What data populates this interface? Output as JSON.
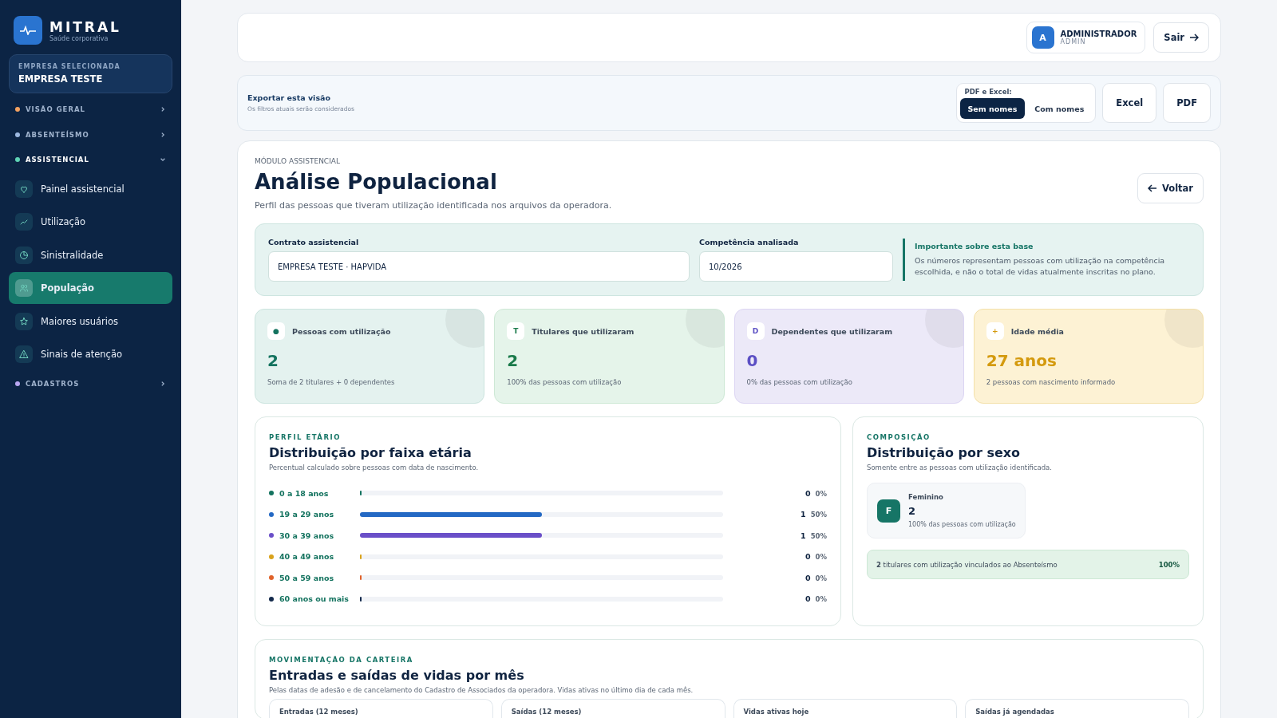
{
  "brand": {
    "name": "MITRAL",
    "tagline": "Saúde corporativa"
  },
  "company": {
    "label": "EMPRESA SELECIONADA",
    "name": "EMPRESA TESTE"
  },
  "nav": [
    {
      "label": "VISÃO GERAL",
      "color": "#f4a261",
      "expanded": false
    },
    {
      "label": "ABSENTEÍSMO",
      "color": "#9db8e0",
      "expanded": false
    },
    {
      "label": "ASSISTENCIAL",
      "color": "#5fd3b5",
      "expanded": true,
      "children": [
        {
          "label": "Painel assistencial",
          "selected": false
        },
        {
          "label": "Utilização",
          "selected": false
        },
        {
          "label": "Sinistralidade",
          "selected": false
        },
        {
          "label": "População",
          "selected": true
        },
        {
          "label": "Maiores usuários",
          "selected": false
        },
        {
          "label": "Sinais de atenção",
          "selected": false
        }
      ]
    },
    {
      "label": "CADASTROS",
      "color": "#b9a6f0",
      "expanded": false
    }
  ],
  "user": {
    "initial": "A",
    "name": "ADMINISTRADOR",
    "role": "ADMIN"
  },
  "logout": "Sair",
  "export": {
    "title": "Exportar esta visão",
    "subtitle": "Os filtros atuais serão considerados",
    "group_label": "PDF e Excel:",
    "options": [
      {
        "label": "Sem nomes",
        "selected": true
      },
      {
        "label": "Com nomes",
        "selected": false
      }
    ],
    "buttons": [
      "Excel",
      "PDF"
    ]
  },
  "header": {
    "eyebrow": "MÓDULO ASSISTENCIAL",
    "title": "Análise Populacional",
    "subtitle": "Perfil das pessoas que tiveram utilização identificada nos arquivos da operadora.",
    "back": "Voltar"
  },
  "filters": {
    "contract": {
      "label": "Contrato assistencial",
      "value": "EMPRESA TESTE · HAPVIDA"
    },
    "period": {
      "label": "Competência analisada",
      "value": "10/2026"
    },
    "note": {
      "title": "Importante sobre esta base",
      "text": "Os números representam pessoas com utilização na competência escolhida, e não o total de vidas atualmente inscritas no plano."
    }
  },
  "kpis": [
    {
      "badge": "●",
      "label": "Pessoas com utilização",
      "value": "2",
      "caption": "Soma de 2 titulares + 0 dependentes",
      "color": "#14735f"
    },
    {
      "badge": "T",
      "label": "Titulares que utilizaram",
      "value": "2",
      "caption": "100% das pessoas com utilização",
      "color": "#1a7a4a"
    },
    {
      "badge": "D",
      "label": "Dependentes que utilizaram",
      "value": "0",
      "caption": "0% das pessoas com utilização",
      "color": "#5b4fc4"
    },
    {
      "badge": "+",
      "label": "Idade média",
      "value": "27 anos",
      "caption": "2 pessoas com nascimento informado",
      "color": "#d49a0e"
    }
  ],
  "age": {
    "eyebrow": "PERFIL ETÁRIO",
    "title": "Distribuição por faixa etária",
    "subtitle": "Percentual calculado sobre pessoas com data de nascimento.",
    "rows": [
      {
        "label": "0 a 18 anos",
        "color": "#14735f",
        "level": 0,
        "count": "0",
        "pct": "0%"
      },
      {
        "label": "19 a 29 anos",
        "color": "#2469c4",
        "level": 0.5,
        "count": "1",
        "pct": "50%"
      },
      {
        "label": "30 a 39 anos",
        "color": "#6a4fc8",
        "level": 0.5,
        "count": "1",
        "pct": "50%"
      },
      {
        "label": "40 a 49 anos",
        "color": "#d9a21b",
        "level": 0,
        "count": "0",
        "pct": "0%"
      },
      {
        "label": "50 a 59 anos",
        "color": "#e0622a",
        "level": 0,
        "count": "0",
        "pct": "0%"
      },
      {
        "label": "60 anos ou mais",
        "color": "#13294b",
        "level": 0,
        "count": "0",
        "pct": "0%"
      }
    ]
  },
  "sex": {
    "eyebrow": "COMPOSIÇÃO",
    "title": "Distribuição por sexo",
    "subtitle": "Somente entre as pessoas com utilização identificada.",
    "cards": [
      {
        "initial": "F",
        "label": "Feminino",
        "value": "2",
        "caption": "100% das pessoas com utilização"
      }
    ],
    "link": {
      "text": "**2** titulares com utilização vinculados ao Absenteísmo",
      "pct": "100%"
    }
  },
  "movement": {
    "eyebrow": "MOVIMENTAÇÃO DA CARTEIRA",
    "title": "Entradas e saídas de vidas por mês",
    "subtitle": "Pelas datas de adesão e de cancelamento do Cadastro de Associados da operadora. Vidas ativas no último dia de cada mês.",
    "cards": [
      "Entradas (12 meses)",
      "Saídas (12 meses)",
      "Vidas ativas hoje",
      "Saídas já agendadas"
    ]
  }
}
